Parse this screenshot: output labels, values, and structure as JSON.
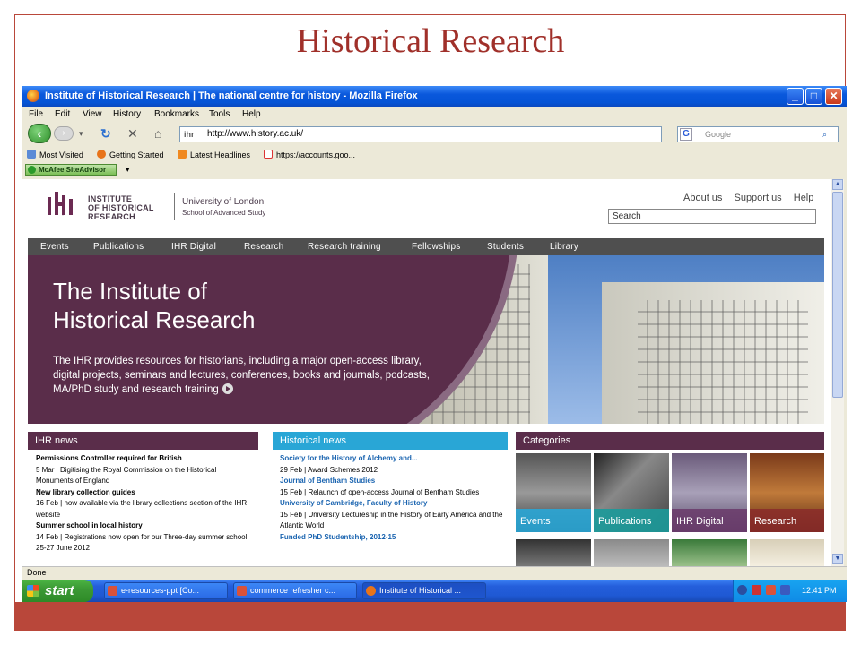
{
  "slide": {
    "title": "Historical Research"
  },
  "window": {
    "title": "Institute of Historical Research  |  The national centre for history - Mozilla Firefox",
    "menu": [
      "File",
      "Edit",
      "View",
      "History",
      "Bookmarks",
      "Tools",
      "Help"
    ],
    "url": "http://www.history.ac.uk/",
    "site_label": "ihr",
    "search_placeholder": "Google",
    "search_engine_glyph": "G",
    "bookmarks": [
      "Most Visited",
      "Getting Started",
      "Latest Headlines",
      "https://accounts.goo..."
    ],
    "mcafee": "McAfee SiteAdvisor",
    "status": "Done"
  },
  "site": {
    "logo_text": "IHR",
    "logo_name": [
      "INSTITUTE",
      "OF HISTORICAL",
      "RESEARCH"
    ],
    "uol": "University of London",
    "sas": "School of Advanced Study",
    "toplinks": [
      "About us",
      "Support us",
      "Help"
    ],
    "search_value": "Search",
    "nav": [
      "Events",
      "Publications",
      "IHR Digital",
      "Research",
      "Research training",
      "Fellowships",
      "Students",
      "Library"
    ],
    "hero_title_1": "The Institute of",
    "hero_title_2": "Historical Research",
    "hero_text": "The IHR provides resources for historians, including a major open-access library, digital projects, seminars and lectures, conferences, books and journals, podcasts, MA/PhD study and research training",
    "ihr_news": {
      "heading": "IHR news",
      "items": [
        {
          "title": "Permissions Controller required for British",
          "date": "5 Mar",
          "text": "Digitising the Royal Commission on the Historical Monuments of England"
        },
        {
          "title": "New library collection guides",
          "date": "16 Feb",
          "text": "now available via the library collections section of the IHR website"
        },
        {
          "title": "Summer school in local history",
          "date": "14 Feb",
          "text": "Registrations now open for our Three-day summer school, 25-27 June 2012"
        }
      ]
    },
    "historical_news": {
      "heading": "Historical news",
      "items": [
        {
          "title": "Society for the History of Alchemy and...",
          "date": "29 Feb",
          "text": "Award Schemes 2012"
        },
        {
          "title": "Journal of Bentham Studies",
          "date": "15 Feb",
          "text": "Relaunch of open-access Journal of Bentham Studies"
        },
        {
          "title": "University of Cambridge, Faculty of History",
          "date": "15 Feb",
          "text": "University Lectureship in the History of Early America and the Atlantic World"
        },
        {
          "title": "Funded PhD Studentship, 2012-15",
          "date": "",
          "text": ""
        }
      ]
    },
    "categories": {
      "heading": "Categories",
      "tiles": [
        "Events",
        "Publications",
        "IHR Digital",
        "Research"
      ]
    }
  },
  "taskbar": {
    "start": "start",
    "tasks": [
      "e-resources-ppt [Co...",
      "commerce refresher c...",
      "Institute of Historical ..."
    ],
    "clock": "12:41 PM"
  },
  "colors": {
    "accent": "#b9473a",
    "title": "#a0302a",
    "ihr_purple": "#5a2d4a",
    "news_blue": "#29a6d6"
  }
}
